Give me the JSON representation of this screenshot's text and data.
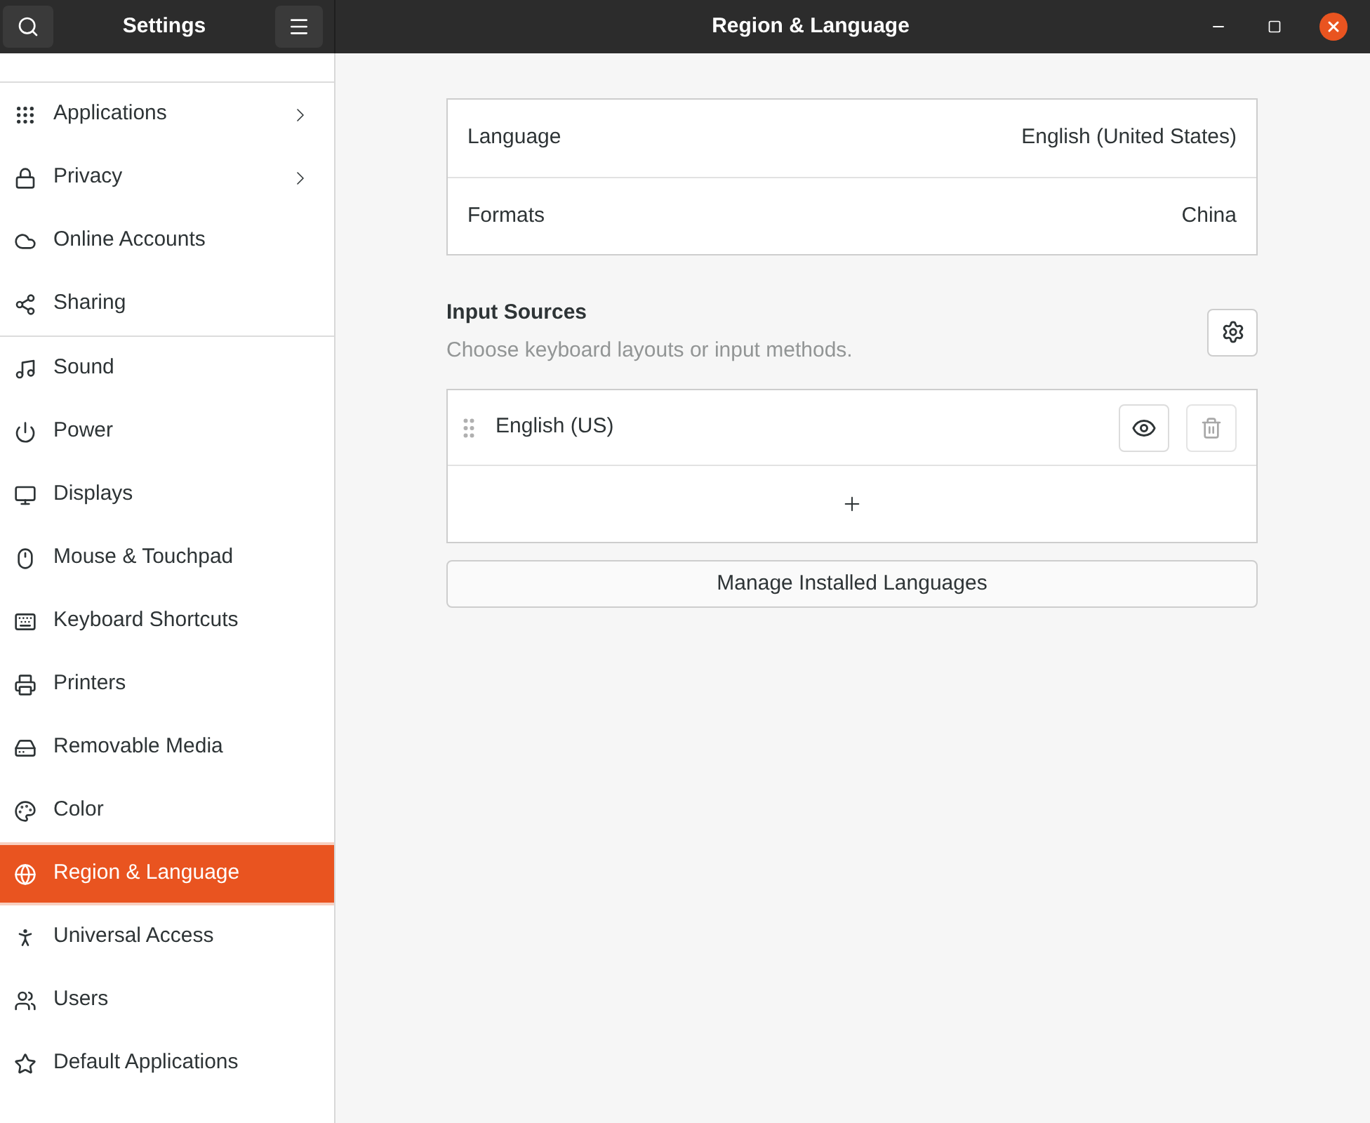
{
  "sidebar_header": {
    "title": "Settings"
  },
  "window": {
    "title": "Region & Language"
  },
  "sidebar": {
    "groups": [
      {
        "items": [
          {
            "label": "Applications",
            "has_submenu": true,
            "selected": false
          },
          {
            "label": "Privacy",
            "has_submenu": true,
            "selected": false
          },
          {
            "label": "Online Accounts",
            "has_submenu": false,
            "selected": false
          },
          {
            "label": "Sharing",
            "has_submenu": false,
            "selected": false
          }
        ]
      },
      {
        "items": [
          {
            "label": "Sound",
            "has_submenu": false,
            "selected": false
          },
          {
            "label": "Power",
            "has_submenu": false,
            "selected": false
          },
          {
            "label": "Displays",
            "has_submenu": false,
            "selected": false
          },
          {
            "label": "Mouse & Touchpad",
            "has_submenu": false,
            "selected": false
          },
          {
            "label": "Keyboard Shortcuts",
            "has_submenu": false,
            "selected": false
          },
          {
            "label": "Printers",
            "has_submenu": false,
            "selected": false
          },
          {
            "label": "Removable Media",
            "has_submenu": false,
            "selected": false
          },
          {
            "label": "Color",
            "has_submenu": false,
            "selected": false
          },
          {
            "label": "Region & Language",
            "has_submenu": false,
            "selected": true
          },
          {
            "label": "Universal Access",
            "has_submenu": false,
            "selected": false
          },
          {
            "label": "Users",
            "has_submenu": false,
            "selected": false
          },
          {
            "label": "Default Applications",
            "has_submenu": false,
            "selected": false
          }
        ]
      }
    ]
  },
  "settings": [
    {
      "label": "Language",
      "value": "English (United States)"
    },
    {
      "label": "Formats",
      "value": "China"
    }
  ],
  "input_sources": {
    "title": "Input Sources",
    "subtitle": "Choose keyboard layouts or input methods.",
    "sources": [
      {
        "name": "English (US)",
        "remove_disabled": true
      }
    ]
  },
  "manage_button": "Manage Installed Languages"
}
